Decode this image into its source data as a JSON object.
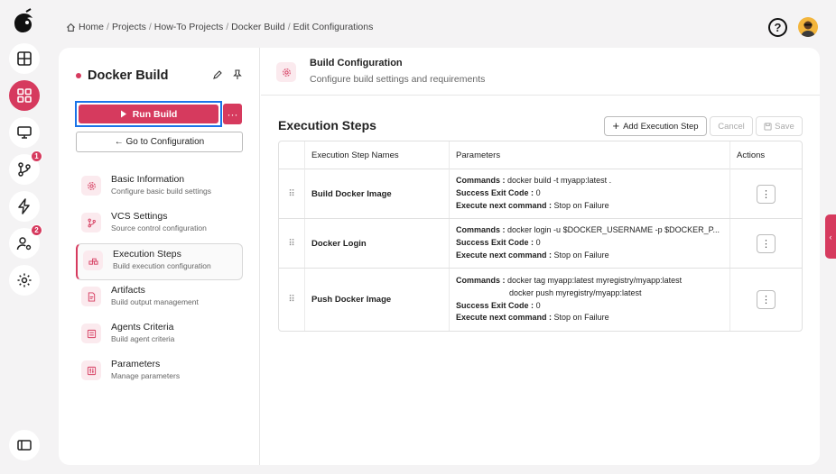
{
  "breadcrumb": [
    "Home",
    "Projects",
    "How-To Projects",
    "Docker Build",
    "Edit Configurations"
  ],
  "rail": {
    "badges": {
      "vcs": "1",
      "users": "2"
    }
  },
  "help_label": "?",
  "project": {
    "name": "Docker Build",
    "run_label": "Run Build",
    "more_label": "···",
    "goto_label": "← Go to Configuration"
  },
  "nav": [
    {
      "title": "Basic Information",
      "subtitle": "Configure basic build settings",
      "icon": "gear-icon"
    },
    {
      "title": "VCS Settings",
      "subtitle": "Source control configuration",
      "icon": "branch-icon"
    },
    {
      "title": "Execution Steps",
      "subtitle": "Build execution configuration",
      "icon": "steps-icon"
    },
    {
      "title": "Artifacts",
      "subtitle": "Build output management",
      "icon": "file-icon"
    },
    {
      "title": "Agents Criteria",
      "subtitle": "Build agent criteria",
      "icon": "agent-icon"
    },
    {
      "title": "Parameters",
      "subtitle": "Manage parameters",
      "icon": "params-icon"
    }
  ],
  "config": {
    "title": "Build Configuration",
    "subtitle": "Configure build settings and requirements"
  },
  "section": {
    "title": "Execution Steps",
    "add_label": "Add Execution Step",
    "cancel_label": "Cancel",
    "save_label": "Save"
  },
  "table": {
    "headers": [
      "Execution Step Names",
      "Parameters",
      "Actions"
    ],
    "labels": {
      "commands": "Commands :",
      "exit": "Success Exit Code :",
      "next": "Execute next command :"
    },
    "rows": [
      {
        "name": "Build Docker Image",
        "commands": [
          "docker build -t myapp:latest ."
        ],
        "exit_code": "0",
        "next": "Stop on Failure"
      },
      {
        "name": "Docker Login",
        "commands": [
          "docker login -u $DOCKER_USERNAME -p $DOCKER_P..."
        ],
        "exit_code": "0",
        "next": "Stop on Failure"
      },
      {
        "name": "Push Docker Image",
        "commands": [
          "docker tag myapp:latest myregistry/myapp:latest",
          "docker push myregistry/myapp:latest"
        ],
        "exit_code": "0",
        "next": "Stop on Failure"
      }
    ]
  },
  "colors": {
    "accent": "#d63a5e",
    "focus": "#1a73e8"
  }
}
